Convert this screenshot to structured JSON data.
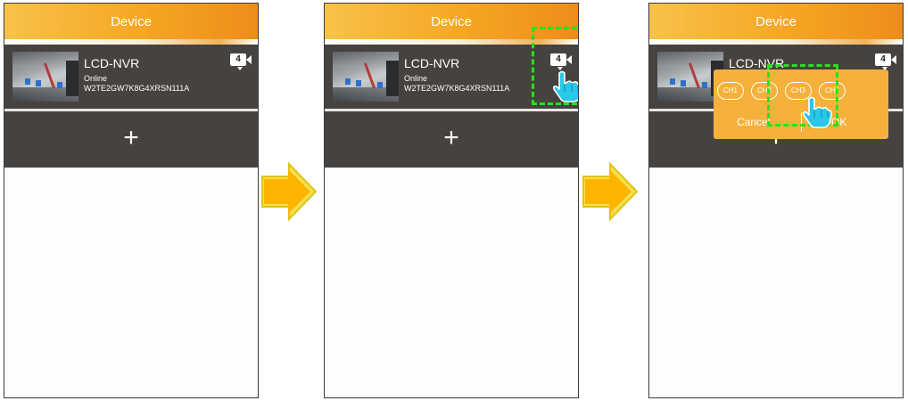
{
  "steps": [
    {
      "header_title": "Device",
      "device": {
        "name": "LCD-NVR",
        "status": "Online",
        "serial": "W2TE2GW7K8G4XRSN111A",
        "channel_count": "4"
      },
      "add_symbol": "+"
    },
    {
      "header_title": "Device",
      "device": {
        "name": "LCD-NVR",
        "status": "Online",
        "serial": "W2TE2GW7K8G4XRSN111A",
        "channel_count": "4"
      },
      "add_symbol": "+"
    },
    {
      "header_title": "Device",
      "device": {
        "name": "LCD-NVR",
        "channel_count": "4"
      },
      "add_symbol": "+",
      "channel_popup": {
        "channels": [
          "CH1",
          "CH2",
          "CH3",
          "CH4"
        ],
        "cancel_label": "Cancel",
        "ok_label": "OK"
      }
    }
  ],
  "colors": {
    "header": "#f5a623",
    "row_bg": "#46423f",
    "popup": "#f5b13b",
    "highlight_box": "#22e41c",
    "pointer_hand": "#29c8e8",
    "arrow": "#ffb400"
  },
  "icons": [
    "audio-speaker-icon",
    "caret-down-icon",
    "pointer-hand-icon",
    "step-arrow-icon"
  ]
}
